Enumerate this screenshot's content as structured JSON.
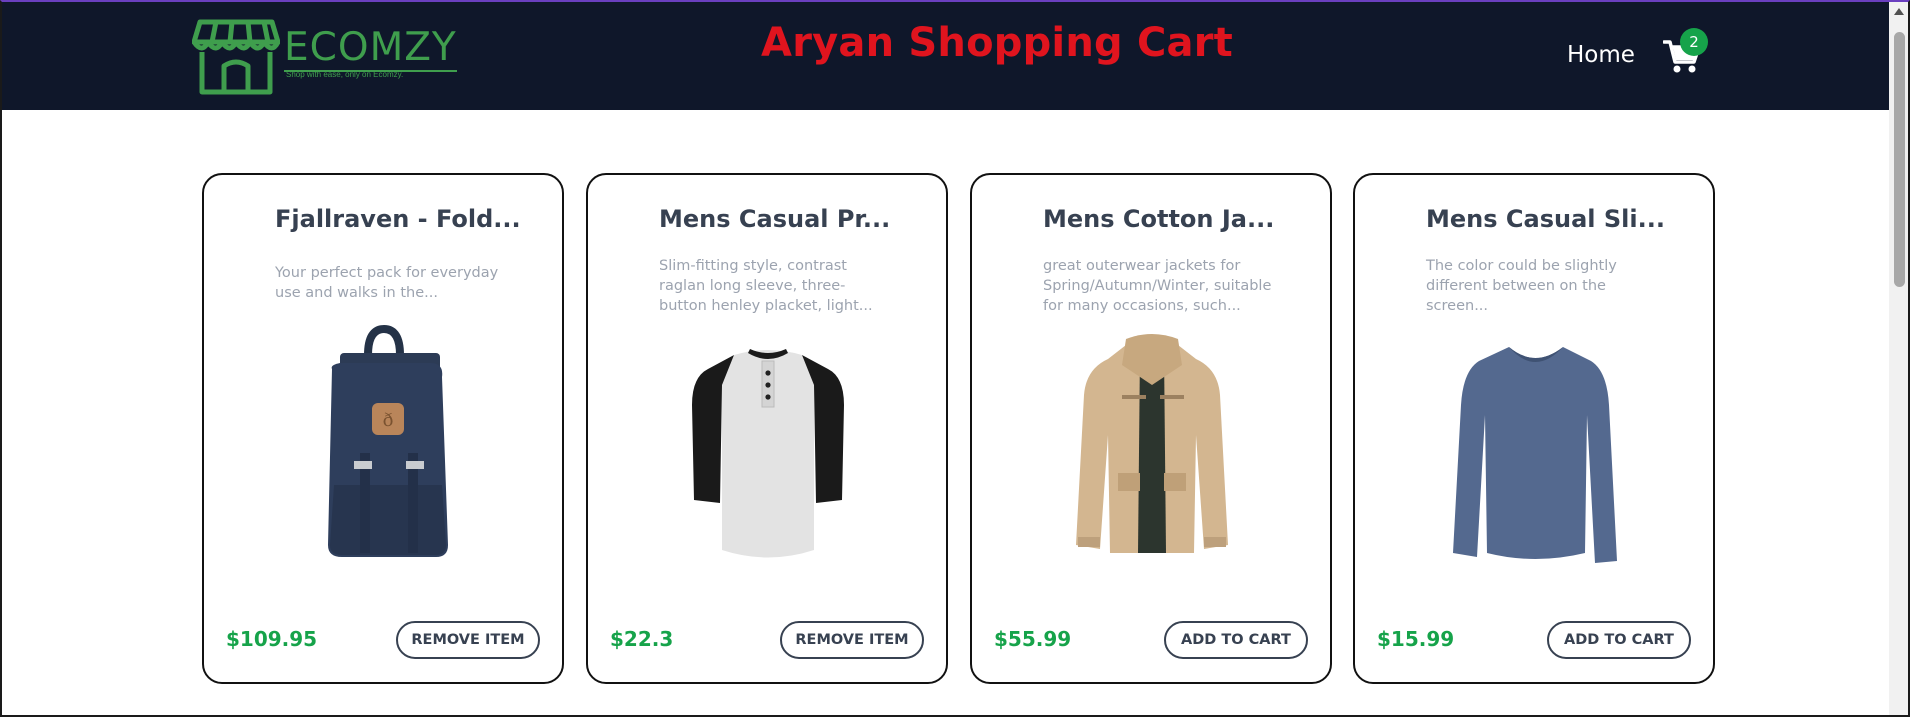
{
  "header": {
    "logo_text": "ECOMZY",
    "logo_tagline": "Shop with ease, only on Ecomzy.",
    "title": "Aryan Shopping Cart",
    "nav_home": "Home",
    "cart_count": "2",
    "colors": {
      "background": "#0f172a",
      "title": "#e0141e",
      "brand": "#3f9e4d",
      "badge": "#16a34a"
    }
  },
  "products": [
    {
      "title": "Fjallraven - Fold...",
      "description": "Your perfect pack for everyday use and walks in the...",
      "image_icon": "backpack-icon",
      "price": "$109.95",
      "button": "REMOVE ITEM"
    },
    {
      "title": "Mens Casual Pr...",
      "description": "Slim-fitting style, contrast raglan long sleeve, three-button henley placket, light...",
      "image_icon": "raglan-shirt-icon",
      "price": "$22.3",
      "button": "REMOVE ITEM"
    },
    {
      "title": "Mens Cotton Ja...",
      "description": "great outerwear jackets for Spring/Autumn/Winter, suitable for many occasions, such...",
      "image_icon": "jacket-icon",
      "price": "$55.99",
      "button": "ADD TO CART"
    },
    {
      "title": "Mens Casual Sli...",
      "description": "The color could be slightly different between on the screen...",
      "image_icon": "long-sleeve-tee-icon",
      "price": "$15.99",
      "button": "ADD TO CART"
    }
  ]
}
